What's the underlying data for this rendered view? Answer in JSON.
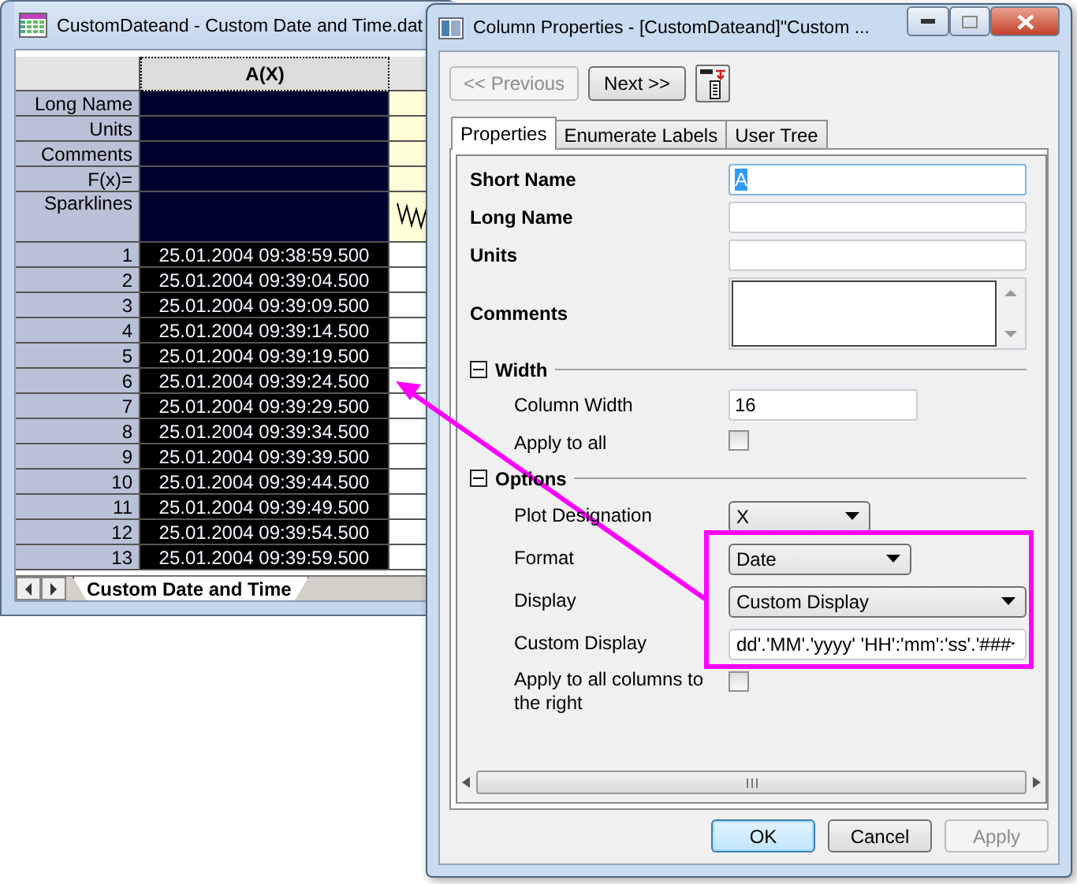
{
  "worksheet": {
    "title": "CustomDateand - Custom Date and Time.dat",
    "column_header": "A(X)",
    "label_rows": [
      "Long Name",
      "Units",
      "Comments",
      "F(x)=",
      "Sparklines"
    ],
    "rows": [
      {
        "number": "1",
        "value": "25.01.2004 09:38:59.500"
      },
      {
        "number": "2",
        "value": "25.01.2004 09:39:04.500"
      },
      {
        "number": "3",
        "value": "25.01.2004 09:39:09.500"
      },
      {
        "number": "4",
        "value": "25.01.2004 09:39:14.500"
      },
      {
        "number": "5",
        "value": "25.01.2004 09:39:19.500"
      },
      {
        "number": "6",
        "value": "25.01.2004 09:39:24.500"
      },
      {
        "number": "7",
        "value": "25.01.2004 09:39:29.500"
      },
      {
        "number": "8",
        "value": "25.01.2004 09:39:34.500"
      },
      {
        "number": "9",
        "value": "25.01.2004 09:39:39.500"
      },
      {
        "number": "10",
        "value": "25.01.2004 09:39:44.500"
      },
      {
        "number": "11",
        "value": "25.01.2004 09:39:49.500"
      },
      {
        "number": "12",
        "value": "25.01.2004 09:39:54.500"
      },
      {
        "number": "13",
        "value": "25.01.2004 09:39:59.500"
      }
    ],
    "sheet_tab": "Custom Date and Time"
  },
  "dialog": {
    "title": "Column Properties - [CustomDateand]\"Custom ...",
    "nav_buttons": [
      {
        "label": "<< Previous",
        "disabled": true
      },
      {
        "label": "Next >>",
        "disabled": false
      }
    ],
    "tabs": [
      {
        "label": "Properties",
        "selected": true
      },
      {
        "label": "Enumerate Labels",
        "selected": false
      },
      {
        "label": "User Tree",
        "selected": false
      }
    ],
    "fields": [
      {
        "kind": "text",
        "label": "Short Name",
        "value": "A",
        "highlighted": true
      },
      {
        "kind": "text",
        "label": "Long Name",
        "highlighted": false
      },
      {
        "kind": "text",
        "label": "Units",
        "highlighted": false
      },
      {
        "kind": "textarea",
        "label": "Comments"
      }
    ],
    "sections": [
      {
        "title": "Width",
        "expanded": true,
        "fields": [
          {
            "kind": "text",
            "label": "Column Width",
            "value": "16",
            "highlighted": false
          },
          {
            "kind": "checkbox",
            "label": "Apply to all",
            "checked": false
          }
        ]
      },
      {
        "title": "Options",
        "expanded": true,
        "fields": [
          {
            "kind": "select",
            "label": "Plot Designation",
            "value": "X"
          },
          {
            "kind": "select",
            "label": "Format",
            "value": "Date"
          },
          {
            "kind": "select",
            "label": "Display",
            "value": "Custom Display"
          },
          {
            "kind": "combo",
            "label": "Custom Display",
            "value": "dd'.'MM'.'yyyy' 'HH':'mm':'ss'.'###"
          },
          {
            "kind": "checkbox",
            "label": "Apply to all columns to the right",
            "checked": false
          }
        ]
      }
    ],
    "buttons": [
      {
        "label": "OK",
        "default": true,
        "disabled": false
      },
      {
        "label": "Cancel",
        "default": false,
        "disabled": false
      },
      {
        "label": "Apply",
        "default": false,
        "disabled": true
      }
    ]
  }
}
